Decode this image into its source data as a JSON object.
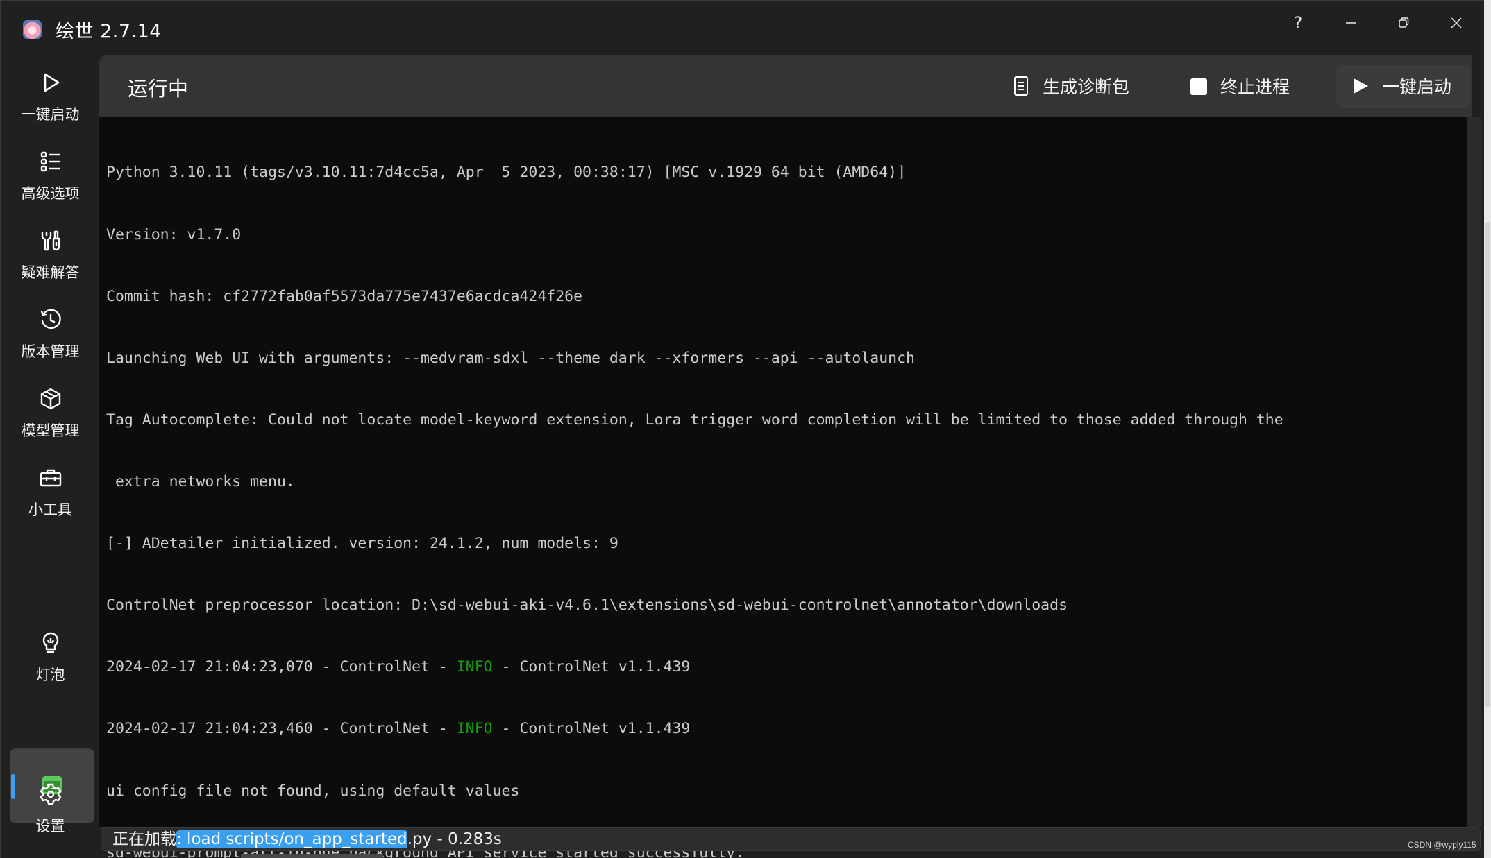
{
  "window": {
    "app_icon": "app-avatar-icon",
    "title": "绘世 2.7.14",
    "controls": {
      "help": "?",
      "minimize": "minimize-icon",
      "restore": "restore-icon",
      "close": "close-icon"
    }
  },
  "sidebar": {
    "items": [
      {
        "label": "一键启动",
        "icon": "play-icon"
      },
      {
        "label": "高级选项",
        "icon": "list-icon"
      },
      {
        "label": "疑难解答",
        "icon": "tools-icon"
      },
      {
        "label": "版本管理",
        "icon": "history-icon"
      },
      {
        "label": "模型管理",
        "icon": "box-icon"
      },
      {
        "label": "小工具",
        "icon": "toolbox-icon"
      },
      {
        "label": "灯泡",
        "icon": "lightbulb-icon"
      },
      {
        "label": "",
        "icon": "terminal-icon",
        "active": true
      },
      {
        "label": "设置",
        "icon": "gear-icon"
      }
    ],
    "accent_color": "#3aa0f8",
    "active_icon_color": "#5cc95c"
  },
  "header": {
    "title": "运行中",
    "buttons": {
      "diagnostics": "生成诊断包",
      "stop": "终止进程",
      "start": "一键启动"
    }
  },
  "terminal": {
    "lines": [
      "Python 3.10.11 (tags/v3.10.11:7d4cc5a, Apr  5 2023, 00:38:17) [MSC v.1929 64 bit (AMD64)]",
      "Version: v1.7.0",
      "Commit hash: cf2772fab0af5573da775e7437e6acdca424f26e",
      "Launching Web UI with arguments: --medvram-sdxl --theme dark --xformers --api --autolaunch",
      "Tag Autocomplete: Could not locate model-keyword extension, Lora trigger word completion will be limited to those added through the",
      " extra networks menu.",
      "[-] ADetailer initialized. version: 24.1.2, num models: 9",
      "ControlNet preprocessor location: D:\\sd-webui-aki-v4.6.1\\extensions\\sd-webui-controlnet\\annotator\\downloads"
    ],
    "log1": {
      "prefix": "2024-02-17 21:04:23,070 - ControlNet - ",
      "level": "INFO",
      "suffix": " - ControlNet v1.1.439"
    },
    "log2": {
      "prefix": "2024-02-17 21:04:23,460 - ControlNet - ",
      "level": "INFO",
      "suffix": " - ControlNet v1.1.439"
    },
    "tail": [
      "ui config file not found, using default values",
      "sd-webui-prompt-all-in-one background API service started successfully."
    ],
    "info_color": "#13a10e"
  },
  "status": {
    "prefix": "正在加载",
    "selected": ": load scripts/on_app_started",
    "suffix": ".py - 0.283s"
  },
  "watermark": "CSDN @wyply115"
}
